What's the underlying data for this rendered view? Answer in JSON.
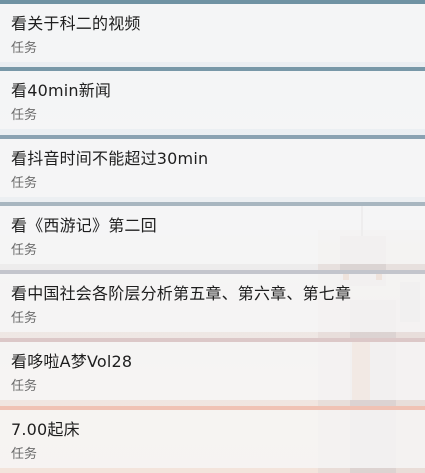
{
  "tasks": [
    {
      "title": "看关于科二的视频",
      "subtitle": "任务",
      "accent": "#6f92a3"
    },
    {
      "title": "看40min新闻",
      "subtitle": "任务",
      "accent": "#7898a8"
    },
    {
      "title": "看抖音时间不能超过30min",
      "subtitle": "任务",
      "accent": "#8aa2b2"
    },
    {
      "title": "看《西游记》第二回",
      "subtitle": "任务",
      "accent": "#a8b6c0"
    },
    {
      "title": "看中国社会各阶层分析第五章、第六章、第七章",
      "subtitle": "任务",
      "accent": "#c3c5cc"
    },
    {
      "title": "看哆啦A梦Vol28",
      "subtitle": "任务",
      "accent": "#dcc8c8"
    },
    {
      "title": "7.00起床",
      "subtitle": "任务",
      "accent": "#f0c2b4"
    }
  ]
}
